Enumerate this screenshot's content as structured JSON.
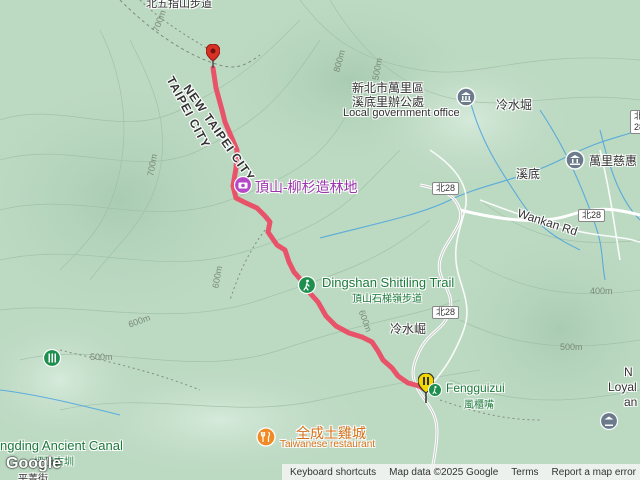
{
  "map": {
    "labels": {
      "top_cut": "北五指山步道",
      "new_taipei_city": "NEW TAIPEI CITY",
      "taipei_city": "TAIPEI CITY",
      "dingshan_forest": "頂山-柳杉造林地",
      "gov_office_zh1": "新北市萬里區",
      "gov_office_zh2": "溪底里辦公處",
      "gov_office_en": "Local government office",
      "lengshuijue": "冷水堀",
      "wanli_temple": "萬里慈惠",
      "xidi": "溪底",
      "wankan_rd": "Wankan Rd",
      "trail_en": "Dingshan Shitiling Trail",
      "trail_zh": "頂山石梯嶺步道",
      "lengshuikeng": "冷水崛",
      "fengguizui_en": "Fengguizui",
      "fengguizui_zh": "風櫃嘴",
      "restaurant_zh": "全成土雞城",
      "restaurant_en": "Taiwanese restaurant",
      "canal_en": "ngding Ancient Canal",
      "canal_zh": "坪頂古圳",
      "loyal_1": "N",
      "loyal_2": "Loyal",
      "loyal_3": "an",
      "bottom_cut": "平菁街"
    },
    "road_shields": [
      "北28",
      "北28",
      "北28",
      "北28"
    ],
    "contours": [
      "800m",
      "700m",
      "600m",
      "500m",
      "600m",
      "500m",
      "600m",
      "500m",
      "400m",
      "700m"
    ]
  },
  "attribution": {
    "logo": "Google",
    "keyboard_shortcuts": "Keyboard shortcuts",
    "map_data": "Map data ©2025 Google",
    "terms": "Terms",
    "report": "Report a map error"
  },
  "colors": {
    "route": "#e8536a",
    "terrain": "#bcd9c2",
    "water": "#4aa3df",
    "start_marker": "#d93025",
    "end_marker": "#f2d600"
  }
}
